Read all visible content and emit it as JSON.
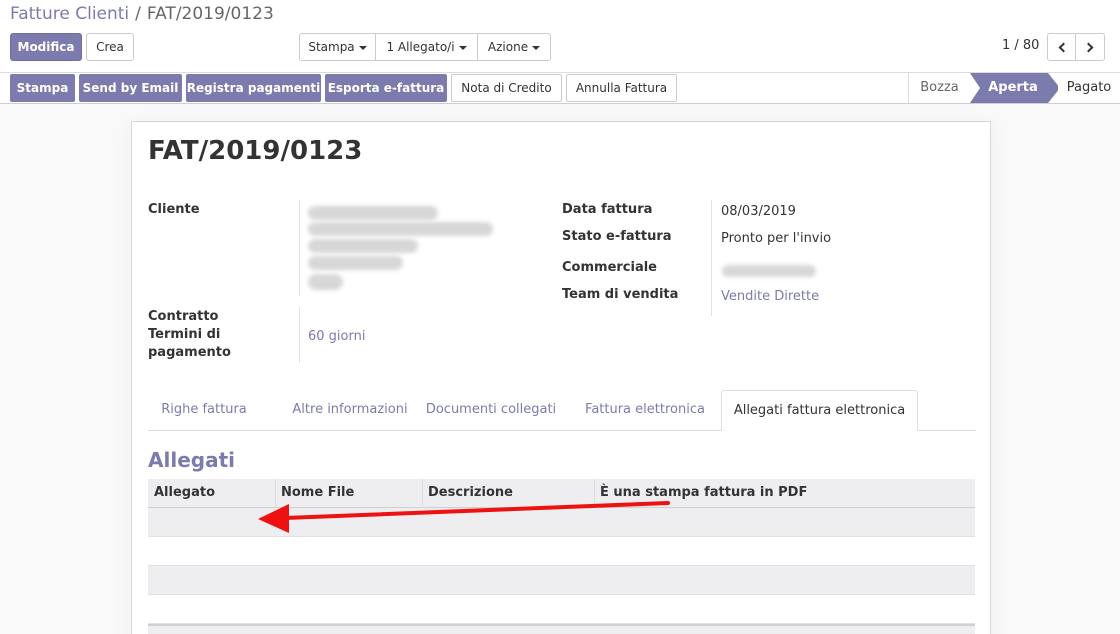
{
  "breadcrumb": {
    "parent": "Fatture Clienti",
    "separator": "/",
    "current": "FAT/2019/0123"
  },
  "toolbar": {
    "edit_label": "Modifica",
    "create_label": "Crea",
    "print_label": "Stampa",
    "attachments_label": "1 Allegato/i",
    "action_label": "Azione"
  },
  "pager": {
    "value": "1 / 80"
  },
  "statusbar": {
    "buttons": [
      "Stampa",
      "Send by Email",
      "Registra pagamenti",
      "Esporta e-fattura",
      "Nota di Credito",
      "Annulla Fattura"
    ],
    "stages": [
      "Bozza",
      "Aperta",
      "Pagato"
    ],
    "active_stage": "Aperta"
  },
  "invoice": {
    "title": "FAT/2019/0123",
    "left": {
      "customer_label": "Cliente",
      "contract_label": "Contratto",
      "payment_terms_label": "Termini di pagamento",
      "payment_terms_label_line1": "Termini di",
      "payment_terms_label_line2": "pagamento",
      "payment_terms_value": "60 giorni"
    },
    "right": {
      "invoice_date_label": "Data fattura",
      "invoice_date_value": "08/03/2019",
      "einvoice_state_label": "Stato e-fattura",
      "einvoice_state_value": "Pronto per l'invio",
      "salesperson_label": "Commerciale",
      "sales_team_label": "Team di vendita",
      "sales_team_value": "Vendite Dirette"
    }
  },
  "tabs": [
    "Righe fattura",
    "Altre informazioni",
    "Documenti collegati",
    "Fattura elettronica",
    "Allegati fattura elettronica"
  ],
  "active_tab": "Allegati fattura elettronica",
  "attachments": {
    "title": "Allegati",
    "columns": [
      "Allegato",
      "Nome File",
      "Descrizione",
      "È una stampa fattura in PDF"
    ],
    "rows": []
  },
  "colors": {
    "accent": "#7c7bad",
    "annotation_arrow": "#ee1111"
  }
}
